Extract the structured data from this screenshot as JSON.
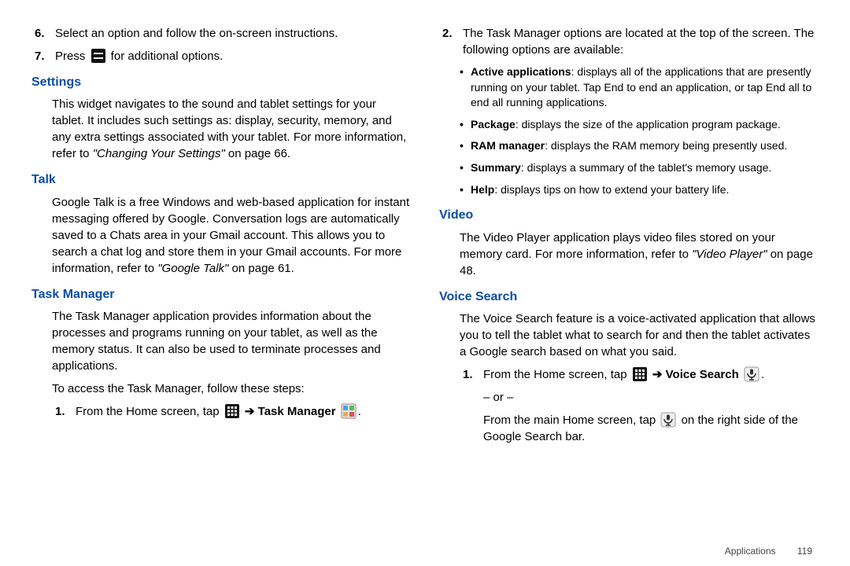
{
  "left": {
    "step6_num": "6.",
    "step6_txt": "Select an option and follow the on-screen instructions.",
    "step7_num": "7.",
    "step7_pre": "Press ",
    "step7_post": " for additional options.",
    "settings_heading": "Settings",
    "settings_pre": "This widget navigates to the sound and tablet settings for your tablet. It includes such settings as: display, security, memory, and any extra settings associated with your tablet. For more information, refer to ",
    "settings_ital": "\"Changing Your Settings\"",
    "settings_post": " on page 66.",
    "talk_heading": "Talk",
    "talk_pre": "Google Talk is a free Windows and web-based application for instant messaging offered by Google. Conversation logs are automatically saved to a Chats area in your Gmail account. This allows you to search a chat log and store them in your Gmail accounts. For more information, refer to ",
    "talk_ital": "\"Google Talk\"",
    "talk_post": " on page 61.",
    "tm_heading": "Task Manager",
    "tm_para1": "The Task Manager application provides information about the processes and programs running on your tablet, as well as the memory status. It can also be used to terminate processes and applications.",
    "tm_para2": "To access the Task Manager, follow these steps:",
    "tm_step1_num": "1.",
    "tm_step1_pre": "From the Home screen, tap ",
    "tm_step1_arrow": " ➔ ",
    "tm_step1_bold": "Task Manager",
    "tm_step1_post": "."
  },
  "right": {
    "step2_num": "2.",
    "step2_txt": "The Task Manager options are located at the top of the screen. The following options are available:",
    "b1_bold": "Active applications",
    "b1_txt": ": displays all of the applications that are presently running on your tablet. Tap End to end an application, or tap End all to end all running applications.",
    "b2_bold": "Package",
    "b2_txt": ": displays the size of the application program package.",
    "b3_bold": "RAM manager",
    "b3_txt": ": displays the RAM memory being presently used.",
    "b4_bold": "Summary",
    "b4_txt": ": displays a summary of the tablet's memory usage.",
    "b5_bold": "Help",
    "b5_txt": ": displays tips on how to extend your battery life.",
    "video_heading": "Video",
    "video_pre": "The Video Player application plays video files stored on your memory card. For more information, refer to ",
    "video_ital": "\"Video Player\"",
    "video_post": " on page 48.",
    "vs_heading": "Voice Search",
    "vs_para": "The Voice Search feature is a voice-activated application that allows you to tell the tablet what to search for and then the tablet activates a Google search based on what you said.",
    "vs_step1_num": "1.",
    "vs_step1_pre": "From the Home screen, tap ",
    "vs_step1_arrow": " ➔ ",
    "vs_step1_bold": "Voice Search",
    "vs_step1_suffix": ".",
    "vs_or": "– or –",
    "vs_alt_pre": "From the main Home screen, tap ",
    "vs_alt_post": " on the right side of the Google Search bar."
  },
  "footer": {
    "section": "Applications",
    "page": "119"
  }
}
